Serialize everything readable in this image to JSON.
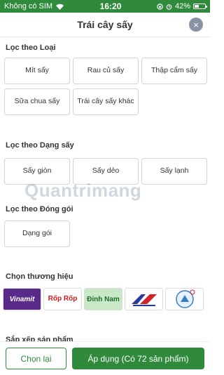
{
  "status_bar": {
    "carrier": "Không có SIM",
    "time": "16:20",
    "battery": "42%",
    "battery_level": 0.42
  },
  "header": {
    "title": "Trái cây sấy",
    "close_icon": "×"
  },
  "filter_type": {
    "title": "Lọc theo Loại",
    "options": [
      "Mít sấy",
      "Rau củ sấy",
      "Thập cẩm sấy",
      "Sữa chua sấy",
      "Trái cây sấy khác"
    ]
  },
  "filter_dry": {
    "title": "Lọc theo Dạng sấy",
    "options": [
      "Sấy giòn",
      "Sấy dẻo",
      "Sấy lạnh"
    ]
  },
  "filter_pack": {
    "title": "Lọc theo Đóng gói",
    "options": [
      "Dạng gói"
    ]
  },
  "brands": {
    "title": "Chọn thương hiệu",
    "items": [
      "Vinamit",
      "Rốp Rốp",
      "Đinh Nam",
      "",
      ""
    ]
  },
  "sort": {
    "title": "Sắp xếp sản phẩm"
  },
  "footer": {
    "reset_label": "Chọn lại",
    "apply_label": "Áp dụng (Có 72 sản phẩm)"
  },
  "watermark": "Quantrimang"
}
